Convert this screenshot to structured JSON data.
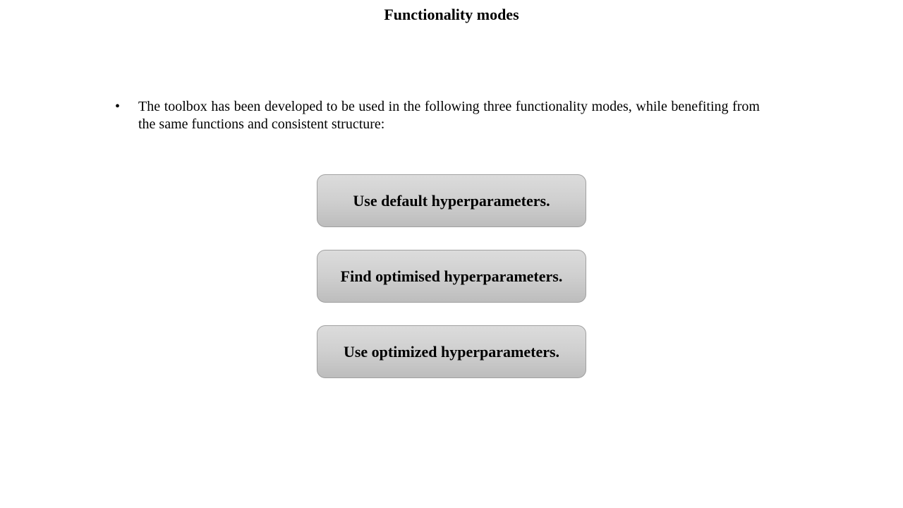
{
  "slide": {
    "title": "Functionality modes",
    "bullet": {
      "marker": "•",
      "text": "The toolbox has been developed to be used in the following three functionality modes, while benefiting from the same functions and consistent structure:"
    },
    "modes": [
      {
        "label": "Use default hyperparameters."
      },
      {
        "label": "Find optimised hyperparameters."
      },
      {
        "label": "Use optimized hyperparameters."
      }
    ]
  }
}
